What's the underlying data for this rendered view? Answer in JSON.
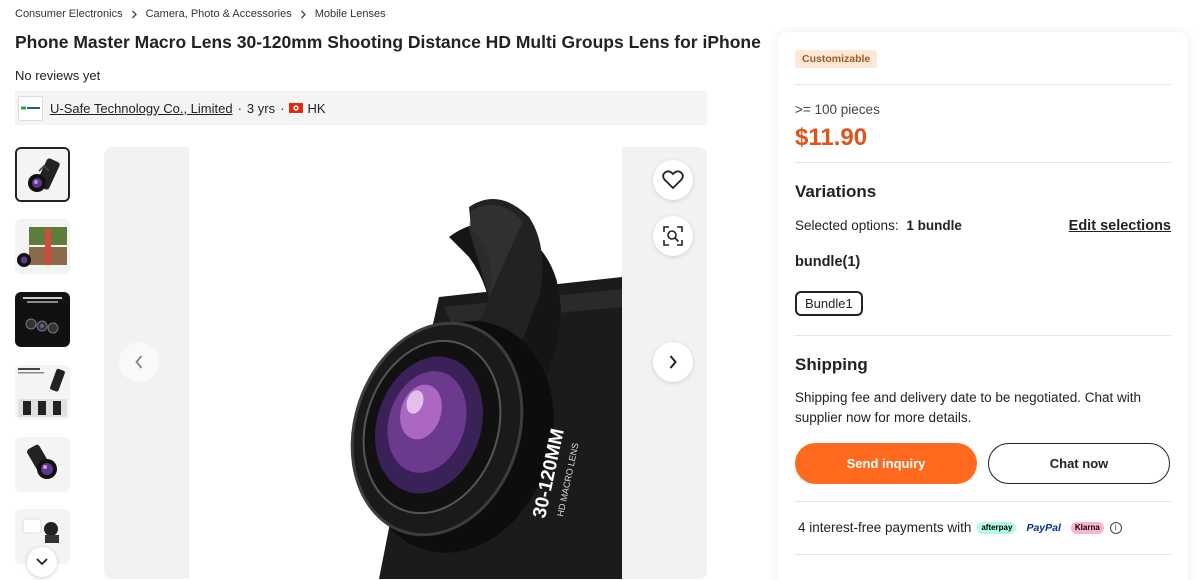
{
  "breadcrumb": [
    "Consumer Electronics",
    "Camera, Photo & Accessories",
    "Mobile Lenses"
  ],
  "product": {
    "title": "Phone Master Macro Lens 30-120mm Shooting Distance HD Multi Groups Lens for iPhone",
    "reviews": "No reviews yet"
  },
  "supplier": {
    "name": "U-Safe Technology Co., Limited",
    "years": "3 yrs",
    "region": "HK"
  },
  "gallery": {
    "lens_text": "30-120MM",
    "lens_subtext": "HD MACRO LENS"
  },
  "panel": {
    "badge": "Customizable",
    "min_order": ">= 100 pieces",
    "price": "$11.90",
    "variations_heading": "Variations",
    "selected_label": "Selected options:",
    "selected_value": "1 bundle",
    "edit_label": "Edit selections",
    "bundle_heading": "bundle(1)",
    "bundle_option": "Bundle1",
    "shipping_heading": "Shipping",
    "shipping_text": "Shipping fee and delivery date to be negotiated. Chat with supplier now for more details.",
    "send_inquiry": "Send inquiry",
    "chat_now": "Chat now",
    "payments_text": "4 interest-free payments with",
    "pay_afterpay": "afterpay",
    "pay_paypal": "PayPal",
    "pay_klarna": "Klarna"
  },
  "colors": {
    "accent": "#ff6a1f",
    "price": "#e0531a",
    "badge_bg": "#fde8d8"
  },
  "icons": {
    "breadcrumb_sep": "chevron-right-icon",
    "favorite": "heart-icon",
    "zoom": "image-search-icon",
    "prev": "chevron-left-icon",
    "next": "chevron-right-icon",
    "thumbs_up": "chevron-up-icon",
    "thumbs_down": "chevron-down-icon",
    "info": "info-icon"
  }
}
